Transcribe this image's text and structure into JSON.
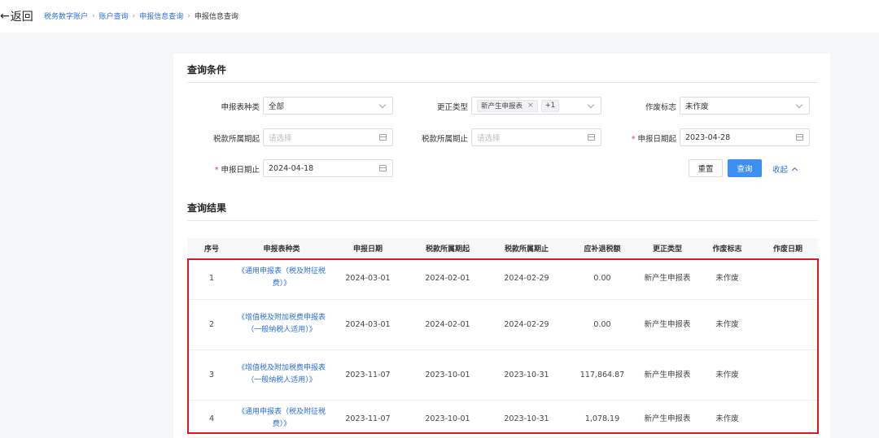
{
  "header": {
    "back_label": "返回",
    "breadcrumb": [
      "税务数字账户",
      "账户查询",
      "申报信息查询",
      "申报信息查询"
    ]
  },
  "query": {
    "title": "查询条件",
    "fields": {
      "report_type": {
        "label": "申报表种类",
        "value": "全部"
      },
      "correction_type": {
        "label": "更正类型",
        "tag": "新产生申报表",
        "more": "+1"
      },
      "void_flag": {
        "label": "作废标志",
        "value": "未作废"
      },
      "tax_period_start": {
        "label": "税款所属期起",
        "placeholder": "请选择"
      },
      "tax_period_end": {
        "label": "税款所属期止",
        "placeholder": "请选择"
      },
      "report_date_start": {
        "label": "申报日期起",
        "value": "2023-04-28",
        "required_mark": "*"
      },
      "report_date_end": {
        "label": "申报日期止",
        "value": "2024-04-18",
        "required_mark": "*"
      }
    },
    "reset_label": "重置",
    "search_label": "查询",
    "collapse_label": "收起"
  },
  "results": {
    "title": "查询结果",
    "columns": [
      "序号",
      "申报表种类",
      "申报日期",
      "税款所属期起",
      "税款所属期止",
      "应补退税额",
      "更正类型",
      "作废标志",
      "作废日期"
    ],
    "rows": [
      {
        "no": "1",
        "type": "《通用申报表（税及附征税费）》",
        "report_date": "2024-03-01",
        "start": "2024-02-01",
        "end": "2024-02-29",
        "amount": "0.00",
        "correction": "新产生申报表",
        "void": "未作废",
        "void_date": ""
      },
      {
        "no": "2",
        "type": "《增值税及附加税费申报表（一般纳税人适用）》",
        "report_date": "2024-03-01",
        "start": "2024-02-01",
        "end": "2024-02-29",
        "amount": "0.00",
        "correction": "新产生申报表",
        "void": "未作废",
        "void_date": ""
      },
      {
        "no": "3",
        "type": "《增值税及附加税费申报表（一般纳税人适用）》",
        "report_date": "2023-11-07",
        "start": "2023-10-01",
        "end": "2023-10-31",
        "amount": "117,864.87",
        "correction": "新产生申报表",
        "void": "未作废",
        "void_date": ""
      },
      {
        "no": "4",
        "type": "《通用申报表（税及附征税费）》",
        "report_date": "2023-11-07",
        "start": "2023-10-01",
        "end": "2023-10-31",
        "amount": "1,078.19",
        "correction": "新产生申报表",
        "void": "未作废",
        "void_date": ""
      }
    ]
  },
  "colors": {
    "accent": "#3d8ff1",
    "link": "#2b6fd8",
    "highlight": "#e1191f",
    "required": "#e34040"
  }
}
